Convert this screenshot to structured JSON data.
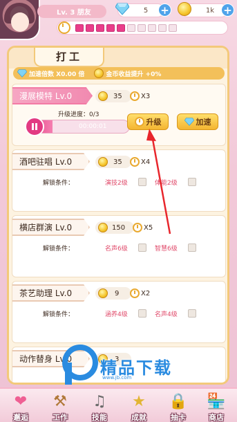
{
  "header": {
    "level_text": "Lv. 3 朋友",
    "diamonds": "5",
    "coins": "1k",
    "energy": {
      "filled": 5,
      "total": 10
    }
  },
  "panel": {
    "title": "打工",
    "boost": {
      "speed_label": "加速倍数 X0.00 倍",
      "coin_label": "金币收益提升 +0%"
    }
  },
  "jobs": [
    {
      "name": "漫展模特 Lv.0",
      "coin": "35",
      "multiplier": "X3",
      "progress_label": "升级进度：0/3",
      "progress_time": "00:00:01",
      "progress": 0.25,
      "upgrade_label": "升级",
      "speedup_label": "加速"
    },
    {
      "name": "酒吧驻唱 Lv.0",
      "coin": "35",
      "multiplier": "X4",
      "unlock_label": "解锁条件：",
      "conditions": [
        "演技2级",
        "体能2级"
      ]
    },
    {
      "name": "横店群演 Lv.0",
      "coin": "150",
      "multiplier": "X5",
      "unlock_label": "解锁条件：",
      "conditions": [
        "名声6级",
        "智慧6级"
      ]
    },
    {
      "name": "茶艺助理 Lv.0",
      "coin": "9",
      "multiplier": "X2",
      "unlock_label": "解锁条件：",
      "conditions": [
        "涵养4级",
        "名声4级"
      ]
    },
    {
      "name": "动作替身 Lv.0",
      "coin": "3",
      "multiplier": ""
    }
  ],
  "nav": [
    {
      "label": "邂逅",
      "icon": "hearts-icon"
    },
    {
      "label": "工作",
      "icon": "hammer-icon"
    },
    {
      "label": "技能",
      "icon": "music-lock-icon"
    },
    {
      "label": "成就",
      "icon": "star-trophy-lock-icon"
    },
    {
      "label": "抽卡",
      "icon": "card-lock-icon"
    },
    {
      "label": "商店",
      "icon": "shop-icon"
    }
  ],
  "watermark": {
    "text": "精品下载",
    "url": "www.jb.com"
  },
  "colors": {
    "accent_pink": "#e23a82",
    "gold": "#f4b531",
    "condition_red": "#e04a6a"
  }
}
